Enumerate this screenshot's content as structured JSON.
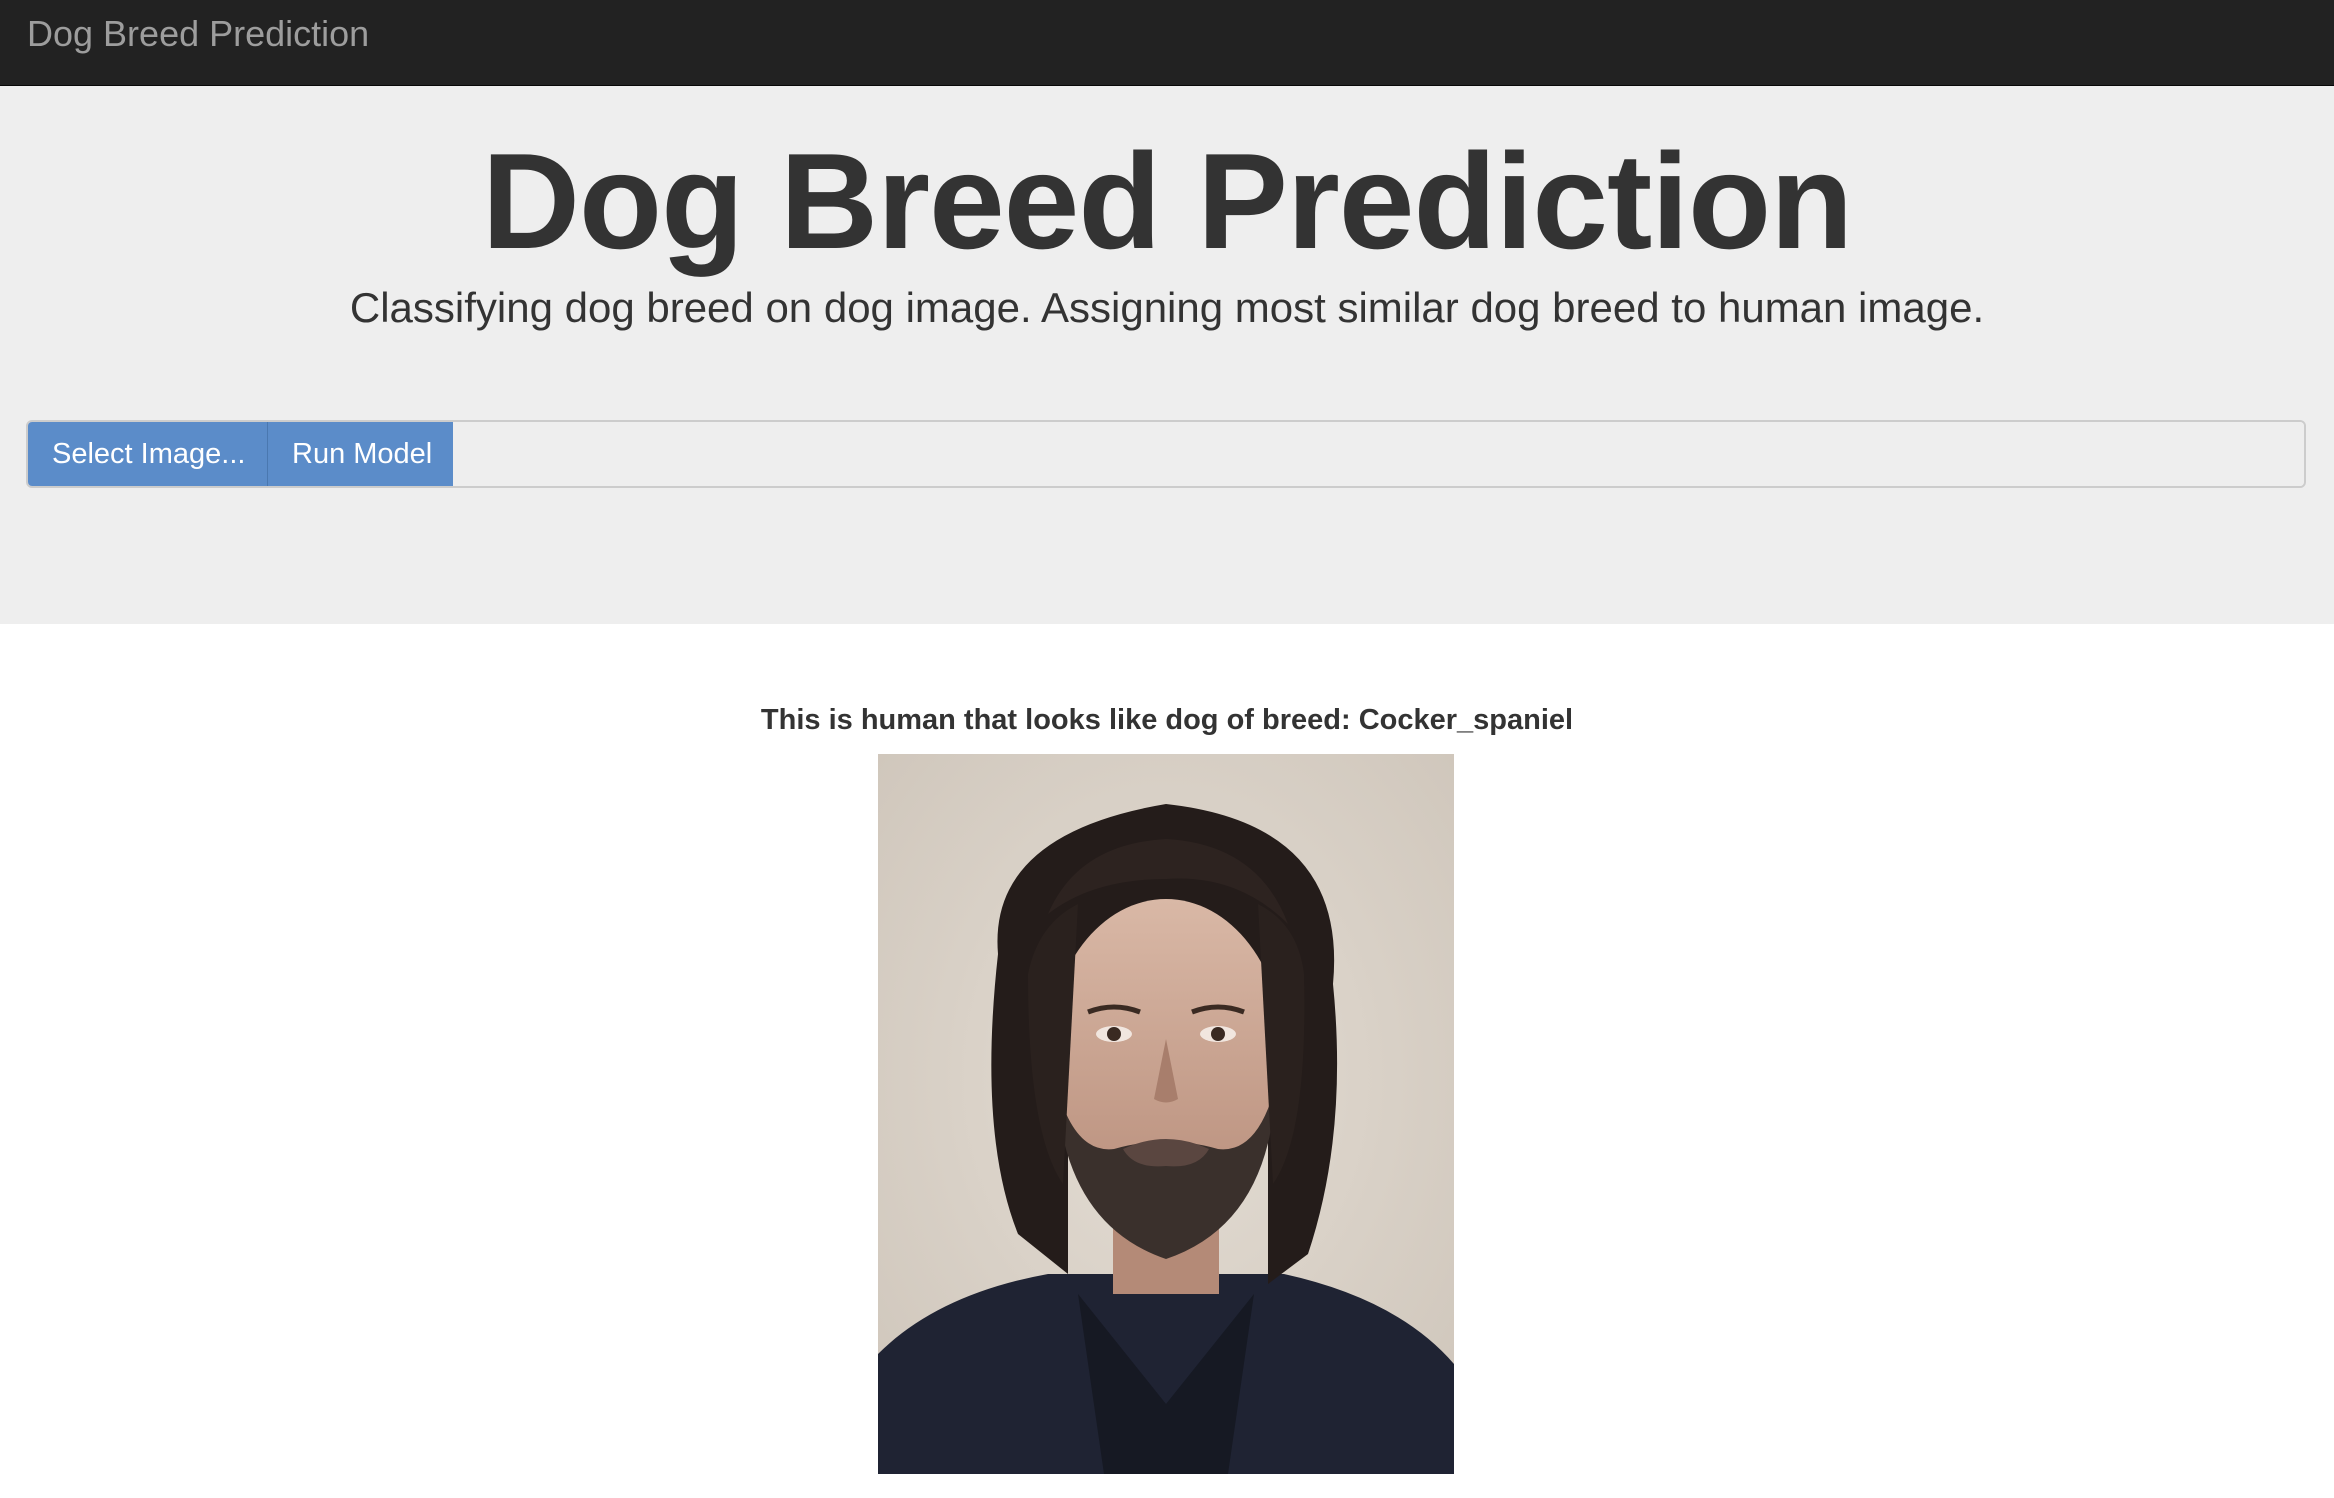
{
  "navbar": {
    "brand": "Dog Breed Prediction"
  },
  "jumbotron": {
    "title": "Dog Breed Prediction",
    "subtitle": "Classifying dog breed on dog image. Assigning most similar dog breed to human image."
  },
  "controls": {
    "select_label": "Select Image...",
    "run_label": "Run Model",
    "file_value": ""
  },
  "result": {
    "text": "This is human that looks like dog of breed: Cocker_spaniel"
  },
  "colors": {
    "navbar": "#222222",
    "jumbotron": "#eeeeee",
    "button": "#5b8cc9",
    "text": "#333333"
  }
}
